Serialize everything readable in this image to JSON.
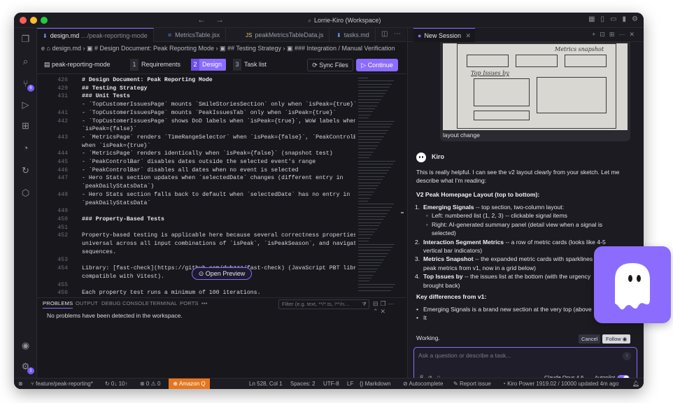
{
  "window": {
    "title": "Lorrie-Kiro (Workspace)"
  },
  "editor": {
    "tabs": [
      {
        "label": "design.md",
        "path": "…/peak-reporting-mode"
      },
      {
        "label": "MetricsTable.jsx"
      },
      {
        "label": "peakMetricsTableData.js"
      },
      {
        "label": "tasks.md"
      }
    ],
    "breadcrumb": "e  ⌂ design.md  ›  ▣ # Design Document: Peak Reporting Mode  ›  ▣ ## Testing Strategy  ›  ▣ ### Integration / Manual Verification",
    "spec_name": "peak-reporting-mode",
    "steps": [
      {
        "num": "1",
        "label": "Requirements"
      },
      {
        "num": "2",
        "label": "Design"
      },
      {
        "num": "3",
        "label": "Task list"
      }
    ],
    "sync_label": "Sync Files",
    "continue_label": "Continue",
    "open_preview_label": "Open Preview",
    "code_lines": [
      {
        "n": "426",
        "t": "# Design Document: Peak Reporting Mode",
        "h": true
      },
      {
        "n": "429",
        "t": "## Testing Strategy",
        "h": true
      },
      {
        "n": "431",
        "t": "### Unit Tests",
        "h": true
      },
      {
        "n": "",
        "t": "- `TopCustomerIssuesPage` mounts `SmileStoriesSection` only when `isPeak={true}`"
      },
      {
        "n": "441",
        "t": "- `TopCustomerIssuesPage` mounts `PeakIssuesTab` only when `isPeak={true}`"
      },
      {
        "n": "442",
        "t": "- `TopCustomerIssuesPage` shows DoD labels when `isPeak={true}`, WoW labels when"
      },
      {
        "n": "",
        "t": "`isPeak={false}`"
      },
      {
        "n": "443",
        "t": "- `MetricsPage` renders `TimeRangeSelector` when `isPeak={false}`, `PeakControlBar`"
      },
      {
        "n": "",
        "t": "when `isPeak={true}`"
      },
      {
        "n": "444",
        "t": "- `MetricsPage` renders identically when `isPeak={false}` (snapshot test)"
      },
      {
        "n": "445",
        "t": "- `PeakControlBar` disables dates outside the selected event's range"
      },
      {
        "n": "446",
        "t": "- `PeakControlBar` disables all dates when no event is selected"
      },
      {
        "n": "447",
        "t": "- Hero Stats section updates when `selectedDate` changes (different entry in"
      },
      {
        "n": "",
        "t": "`peakDailyStatsData`)"
      },
      {
        "n": "448",
        "t": "- Hero Stats section falls back to default when `selectedDate` has no entry in"
      },
      {
        "n": "",
        "t": "`peakDailyStatsData`"
      },
      {
        "n": "449",
        "t": ""
      },
      {
        "n": "450",
        "t": "### Property-Based Tests",
        "h": true
      },
      {
        "n": "451",
        "t": ""
      },
      {
        "n": "452",
        "t": "Property-based testing is applicable here because several correctness properties are"
      },
      {
        "n": "",
        "t": "universal across all input combinations of `isPeak`, `isPeakSeason`, and navigation"
      },
      {
        "n": "",
        "t": "sequences."
      },
      {
        "n": "453",
        "t": ""
      },
      {
        "n": "454",
        "t": "Library: [fast-check](https://github.com/dubzzz/fast-check) (JavaScript PBT library,"
      },
      {
        "n": "",
        "t": "compatible with Vitest)."
      },
      {
        "n": "455",
        "t": ""
      },
      {
        "n": "456",
        "t": "Each property test runs a minimum of 100 iterations."
      }
    ]
  },
  "panel": {
    "tabs": [
      "PROBLEMS",
      "OUTPUT",
      "DEBUG CONSOLE",
      "TERMINAL",
      "PORTS",
      "•••"
    ],
    "filter_placeholder": "Filter (e.g. text, **/*.ts, !**/n…",
    "message": "No problems have been detected in the workspace."
  },
  "chat": {
    "tab_label": "New Session",
    "image_caption": "layout change",
    "sketch_labels": [
      "Metrics snapshot",
      "Top Issues by"
    ],
    "agent_name": "Kiro",
    "intro": "This is really helpful. I can see the v2 layout clearly from your sketch. Let me describe what I'm reading:",
    "section_title": "V2 Peak Homepage Layout (top to bottom):",
    "items": [
      {
        "num": "1.",
        "bold": "Emerging Signals",
        "text": " -- top section, two-column layout:"
      },
      {
        "sub": true,
        "text": "Left: numbered list (1, 2, 3) -- clickable signal items"
      },
      {
        "sub": true,
        "text": "Right: AI-generated summary panel (detail view when a signal is"
      },
      {
        "sub": true,
        "cont": true,
        "text": "selected)"
      },
      {
        "num": "2.",
        "bold": "Interaction Segment Metrics",
        "text": " -- a row of metric cards (looks like 4-5"
      },
      {
        "cont2": true,
        "text": "vertical bar indicators)"
      },
      {
        "num": "3.",
        "bold": "Metrics Snapshot",
        "text": " -- the expanded metric cards with sparklines (the 10"
      },
      {
        "cont2": true,
        "text": "peak metrics from v1, now in a grid below)"
      },
      {
        "num": "4.",
        "bold": "Top Issues by",
        "text": " -- the issues list at the bottom (with the urgency"
      },
      {
        "cont2": true,
        "text": "brought back)"
      }
    ],
    "diff_title": "Key differences from v1:",
    "diff_items": [
      "Emerging Signals is a brand new section at the very top (above",
      "It"
    ],
    "status_text": "Working.",
    "cancel_label": "Cancel",
    "follow_label": "Follow",
    "input_placeholder": "Ask a question or describe a task...",
    "model_label": "Claude Opus 4.6",
    "autopilot_label": "Autopilot"
  },
  "status": {
    "branch": "feature/peak-reporting*",
    "sync": "↻ 0↓ 10↑",
    "errors": "⊗ 0 ⚠ 0",
    "amazon_q": "Amazon Q",
    "position": "Ln 528, Col 1",
    "spaces": "Spaces: 2",
    "encoding": "UTF-8",
    "eol": "LF",
    "language": "Markdown",
    "autocomplete": "Autocomplete",
    "report": "Report issue",
    "kiro_power": "Kiro Power 1919.02 / 10000 updated 4m ago"
  },
  "activity_badges": {
    "scm": "6",
    "account": "1"
  }
}
